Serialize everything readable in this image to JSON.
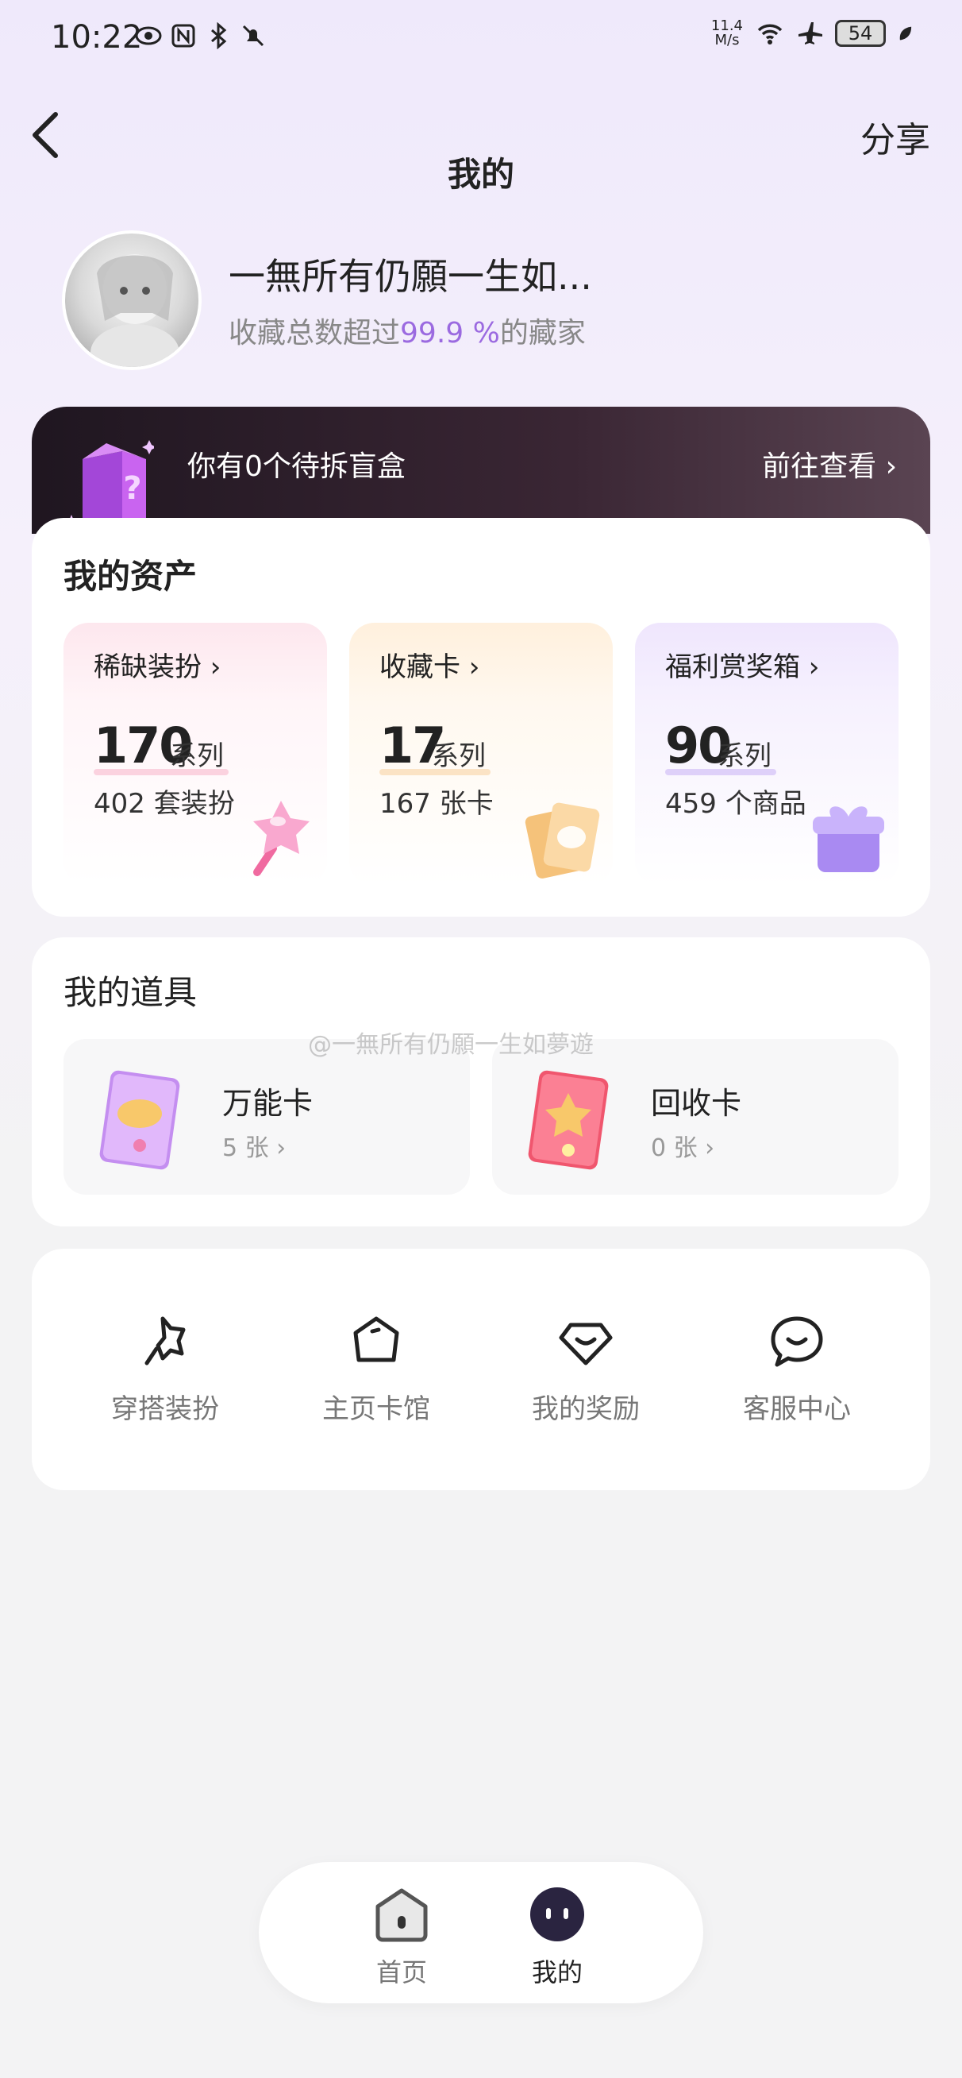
{
  "status_bar": {
    "time": "10:22",
    "net_speed_value": "11.4",
    "net_speed_unit": "M/s",
    "battery": "54"
  },
  "header": {
    "title": "我的",
    "share_label": "分享"
  },
  "profile": {
    "username": "一無所有仍願一生如...",
    "collector_prefix": "收藏总数超过",
    "collector_percent": "99.9 %",
    "collector_suffix": "的藏家"
  },
  "banner": {
    "text": "你有0个待拆盲盒",
    "link_label": "前往查看 ›"
  },
  "assets": {
    "title": "我的资产",
    "cards": [
      {
        "label": "稀缺装扮 ›",
        "number": "170",
        "unit": "系列",
        "sub": "402 套装扮",
        "accent": "#f7b3c8"
      },
      {
        "label": "收藏卡 ›",
        "number": "17",
        "unit": "系列",
        "sub": "167 张卡",
        "accent": "#f8cf9c"
      },
      {
        "label": "福利赏奖箱 ›",
        "number": "90",
        "unit": "系列",
        "sub": "459 个商品",
        "accent": "#c9b0f4"
      }
    ]
  },
  "tools": {
    "title": "我的道具",
    "items": [
      {
        "name": "万能卡",
        "count": "5 张 ›"
      },
      {
        "name": "回收卡",
        "count": "0 张 ›"
      }
    ]
  },
  "watermark": "@一無所有仍願一生如夢遊",
  "shortcuts": [
    {
      "label": "穿搭装扮",
      "icon": "outfit-icon"
    },
    {
      "label": "主页卡馆",
      "icon": "card-hall-icon"
    },
    {
      "label": "我的奖励",
      "icon": "reward-icon"
    },
    {
      "label": "客服中心",
      "icon": "customer-service-icon"
    }
  ],
  "bottom_nav": {
    "items": [
      {
        "label": "首页",
        "icon": "home-icon",
        "active": false
      },
      {
        "label": "我的",
        "icon": "mine-icon",
        "active": true
      }
    ]
  },
  "colors": {
    "accent_purple": "#9b6ae0",
    "banner_dark": "#1f1620"
  }
}
